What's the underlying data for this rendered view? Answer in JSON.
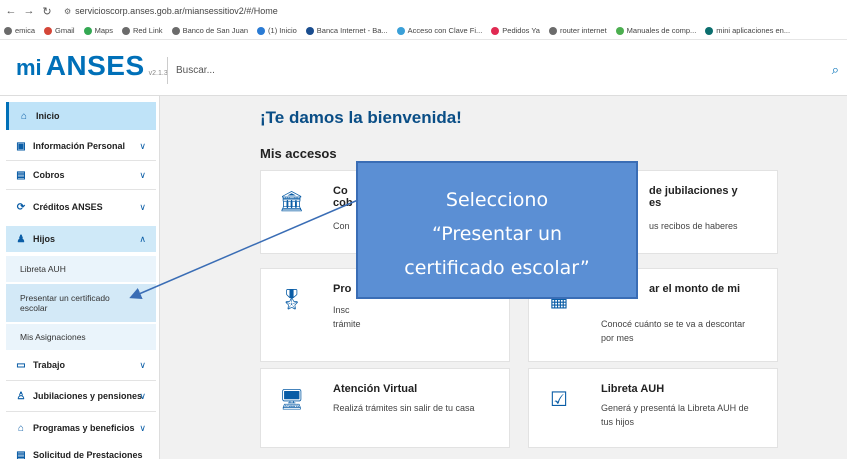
{
  "browser": {
    "url": "servicioscorp.anses.gob.ar/miansessitiov2/#/Home",
    "bookmarks": [
      "emica",
      "Gmail",
      "Maps",
      "Red Link",
      "Banco de San Juan",
      "(1) Inicio",
      "Banca Internet - Ba...",
      "Acceso con Clave Fi...",
      "Pedidos Ya",
      "router internet",
      "Manuales de comp...",
      "mini aplicaciones en..."
    ]
  },
  "header": {
    "logo_mi": "mi",
    "logo_anses": "ANSES",
    "version": "v2.1.3",
    "search_placeholder": "Buscar..."
  },
  "sidebar": {
    "items": [
      {
        "label": "Inicio",
        "icon": "home-icon"
      },
      {
        "label": "Información Personal",
        "icon": "id-card-icon"
      },
      {
        "label": "Cobros",
        "icon": "money-icon"
      },
      {
        "label": "Créditos ANSES",
        "icon": "refresh-money-icon"
      },
      {
        "label": "Hijos",
        "icon": "family-icon"
      },
      {
        "label": "Trabajo",
        "icon": "briefcase-icon"
      },
      {
        "label": "Jubilaciones y pensiones",
        "icon": "couple-icon"
      },
      {
        "label": "Programas y beneficios",
        "icon": "building-icon"
      },
      {
        "label": "Solicitud de Prestaciones",
        "icon": "document-icon"
      }
    ],
    "sub_items": [
      "Libreta AUH",
      "Presentar un certificado escolar",
      "Mis Asignaciones"
    ]
  },
  "main": {
    "welcome": "¡Te damos la bienvenida!",
    "accesos_title": "Mis accesos",
    "cards": [
      {
        "title": "Co",
        "title2": "cob",
        "desc": "Con",
        "icon": "bank-icon"
      },
      {
        "title": "de jubilaciones y",
        "title2": "es",
        "desc": "us recibos de haberes",
        "icon": "receipt-icon"
      },
      {
        "title": "Pro",
        "desc": "Insc",
        "desc2": "trámite",
        "icon": "certificate-icon"
      },
      {
        "title": "ar el monto de mi",
        "desc": "Conocé cuánto se te va a descontar",
        "desc2": "por mes",
        "icon": "calculator-icon"
      },
      {
        "title": "Atención Virtual",
        "desc": "Realizá trámites sin salir de tu casa",
        "icon": "monitor-icon"
      },
      {
        "title": "Libreta AUH",
        "desc": "Generá y presentá la Libreta AUH de",
        "desc2": "tus hijos",
        "icon": "card-check-icon"
      }
    ]
  },
  "callout": {
    "line1": "Selecciono",
    "line2": "“Presentar un",
    "line3": "certificado escolar”",
    "color": "#5b8fd4"
  },
  "colors": {
    "brand": "#0070b8",
    "welcome": "#0a4e86",
    "active_bg": "#bfe3f8"
  }
}
